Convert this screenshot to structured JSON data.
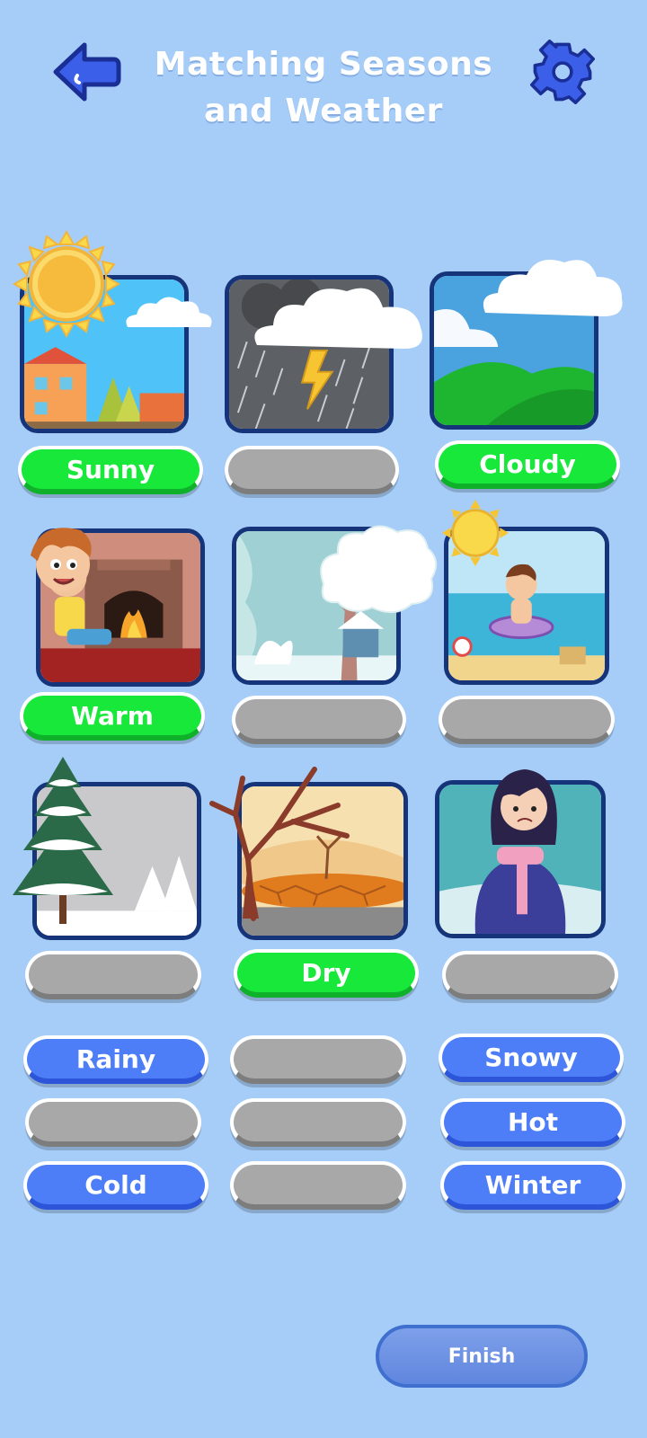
{
  "header": {
    "title": "Matching Seasons and Weather",
    "back_icon": "back-arrow-icon",
    "settings_icon": "gear-icon"
  },
  "cards": [
    {
      "scene": "sunny-town",
      "answer": "Sunny",
      "state": "matched"
    },
    {
      "scene": "storm-rain",
      "answer": "",
      "state": "empty"
    },
    {
      "scene": "cloudy-hills",
      "answer": "Cloudy",
      "state": "matched"
    },
    {
      "scene": "fireplace-boy",
      "answer": "Warm",
      "state": "matched"
    },
    {
      "scene": "snowy-tree-house",
      "answer": "",
      "state": "empty"
    },
    {
      "scene": "beach-swimmer",
      "answer": "",
      "state": "empty"
    },
    {
      "scene": "snow-pine",
      "answer": "",
      "state": "empty"
    },
    {
      "scene": "dry-land",
      "answer": "Dry",
      "state": "matched"
    },
    {
      "scene": "shivering-girl",
      "answer": "",
      "state": "empty"
    }
  ],
  "word_bank": [
    {
      "label": "Rainy",
      "state": "available"
    },
    {
      "label": "",
      "state": "used"
    },
    {
      "label": "Snowy",
      "state": "available"
    },
    {
      "label": "",
      "state": "used"
    },
    {
      "label": "",
      "state": "used"
    },
    {
      "label": "Hot",
      "state": "available"
    },
    {
      "label": "Cold",
      "state": "available"
    },
    {
      "label": "",
      "state": "used"
    },
    {
      "label": "Winter",
      "state": "available"
    }
  ],
  "finish_label": "Finish",
  "colors": {
    "background": "#a6cdf8",
    "matched": "#17e83a",
    "empty": "#a8a8a8",
    "available": "#4d7ef7",
    "card_border": "#16347a"
  }
}
